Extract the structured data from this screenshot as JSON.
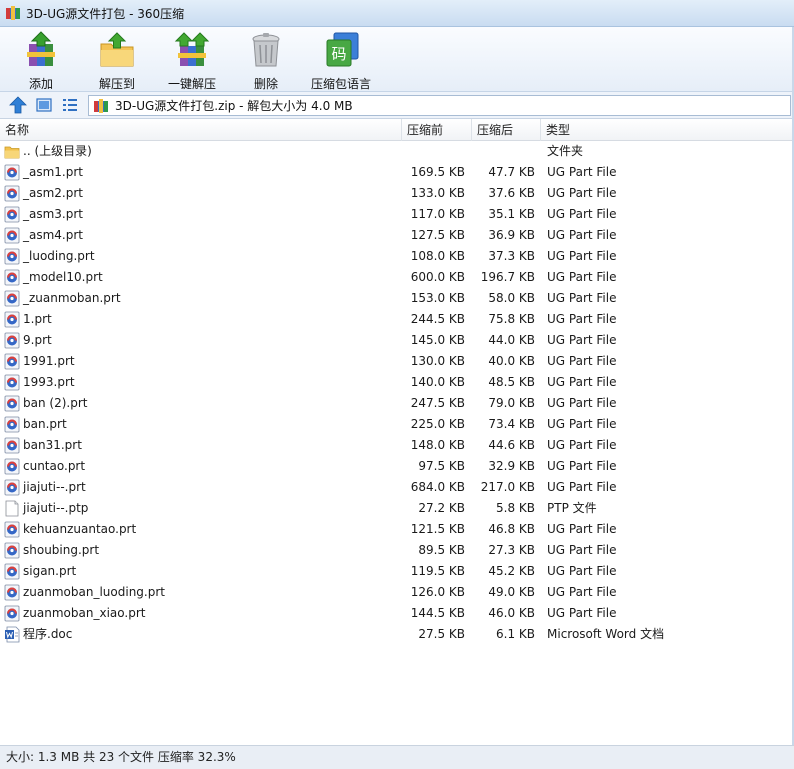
{
  "window": {
    "title": "3D-UG源文件打包 - 360压缩"
  },
  "toolbar": {
    "add_label": "添加",
    "extract_to_label": "解压到",
    "one_click_extract_label": "一键解压",
    "delete_label": "删除",
    "language_label": "压缩包语言",
    "language_icon_glyph": "码"
  },
  "address": {
    "path": "3D-UG源文件打包.zip - 解包大小为 4.0 MB"
  },
  "columns": {
    "name": "名称",
    "before": "压缩前",
    "after": "压缩后",
    "type": "类型"
  },
  "files": [
    {
      "name": ".. (上级目录)",
      "before": "",
      "after": "",
      "type": "文件夹",
      "icon": "folder-icon"
    },
    {
      "name": "_asm1.prt",
      "before": "169.5 KB",
      "after": "47.7 KB",
      "type": "UG Part File",
      "icon": "ug-part-icon"
    },
    {
      "name": "_asm2.prt",
      "before": "133.0 KB",
      "after": "37.6 KB",
      "type": "UG Part File",
      "icon": "ug-part-icon"
    },
    {
      "name": "_asm3.prt",
      "before": "117.0 KB",
      "after": "35.1 KB",
      "type": "UG Part File",
      "icon": "ug-part-icon"
    },
    {
      "name": "_asm4.prt",
      "before": "127.5 KB",
      "after": "36.9 KB",
      "type": "UG Part File",
      "icon": "ug-part-icon"
    },
    {
      "name": "_luoding.prt",
      "before": "108.0 KB",
      "after": "37.3 KB",
      "type": "UG Part File",
      "icon": "ug-part-icon"
    },
    {
      "name": "_model10.prt",
      "before": "600.0 KB",
      "after": "196.7 KB",
      "type": "UG Part File",
      "icon": "ug-part-icon"
    },
    {
      "name": "_zuanmoban.prt",
      "before": "153.0 KB",
      "after": "58.0 KB",
      "type": "UG Part File",
      "icon": "ug-part-icon"
    },
    {
      "name": "1.prt",
      "before": "244.5 KB",
      "after": "75.8 KB",
      "type": "UG Part File",
      "icon": "ug-part-icon"
    },
    {
      "name": "9.prt",
      "before": "145.0 KB",
      "after": "44.0 KB",
      "type": "UG Part File",
      "icon": "ug-part-icon"
    },
    {
      "name": "1991.prt",
      "before": "130.0 KB",
      "after": "40.0 KB",
      "type": "UG Part File",
      "icon": "ug-part-icon"
    },
    {
      "name": "1993.prt",
      "before": "140.0 KB",
      "after": "48.5 KB",
      "type": "UG Part File",
      "icon": "ug-part-icon"
    },
    {
      "name": "ban (2).prt",
      "before": "247.5 KB",
      "after": "79.0 KB",
      "type": "UG Part File",
      "icon": "ug-part-icon"
    },
    {
      "name": "ban.prt",
      "before": "225.0 KB",
      "after": "73.4 KB",
      "type": "UG Part File",
      "icon": "ug-part-icon"
    },
    {
      "name": "ban31.prt",
      "before": "148.0 KB",
      "after": "44.6 KB",
      "type": "UG Part File",
      "icon": "ug-part-icon"
    },
    {
      "name": "cuntao.prt",
      "before": "97.5 KB",
      "after": "32.9 KB",
      "type": "UG Part File",
      "icon": "ug-part-icon"
    },
    {
      "name": "jiajuti--.prt",
      "before": "684.0 KB",
      "after": "217.0 KB",
      "type": "UG Part File",
      "icon": "ug-part-icon"
    },
    {
      "name": "jiajuti--.ptp",
      "before": "27.2 KB",
      "after": "5.8 KB",
      "type": "PTP 文件",
      "icon": "blank-file-icon"
    },
    {
      "name": "kehuanzuantao.prt",
      "before": "121.5 KB",
      "after": "46.8 KB",
      "type": "UG Part File",
      "icon": "ug-part-icon"
    },
    {
      "name": "shoubing.prt",
      "before": "89.5 KB",
      "after": "27.3 KB",
      "type": "UG Part File",
      "icon": "ug-part-icon"
    },
    {
      "name": "sigan.prt",
      "before": "119.5 KB",
      "after": "45.2 KB",
      "type": "UG Part File",
      "icon": "ug-part-icon"
    },
    {
      "name": "zuanmoban_luoding.prt",
      "before": "126.0 KB",
      "after": "49.0 KB",
      "type": "UG Part File",
      "icon": "ug-part-icon"
    },
    {
      "name": "zuanmoban_xiao.prt",
      "before": "144.5 KB",
      "after": "46.0 KB",
      "type": "UG Part File",
      "icon": "ug-part-icon"
    },
    {
      "name": "程序.doc",
      "before": "27.5 KB",
      "after": "6.1 KB",
      "type": "Microsoft Word 文档",
      "icon": "word-doc-icon"
    }
  ],
  "status": {
    "text": "大小: 1.3 MB 共 23 个文件 压缩率 32.3%"
  }
}
